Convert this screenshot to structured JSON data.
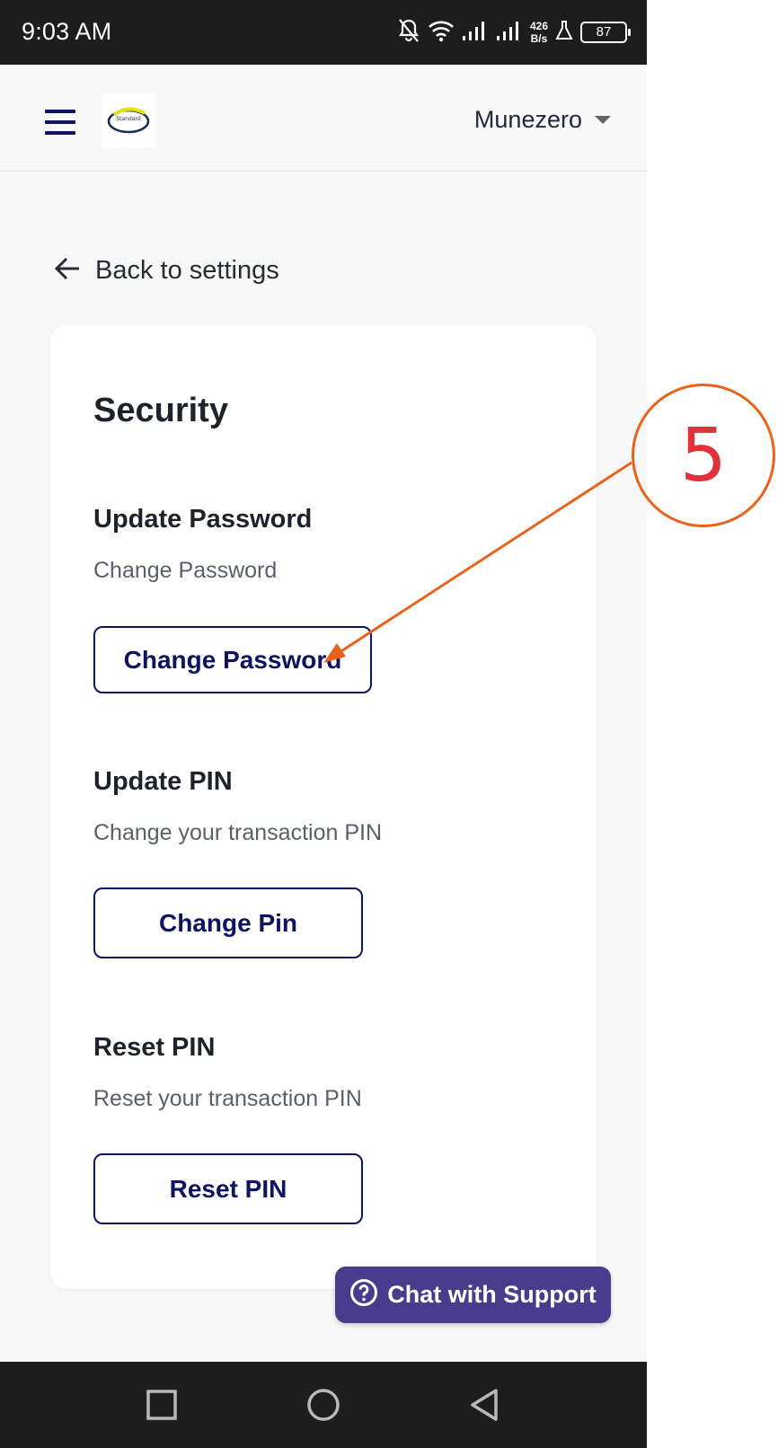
{
  "status_bar": {
    "time": "9:03 AM",
    "net_speed_value": "426",
    "net_speed_unit": "B/s",
    "battery": "87"
  },
  "header": {
    "user_name": "Munezero",
    "logo_text": "Standard"
  },
  "back_link": {
    "label": "Back to settings"
  },
  "card": {
    "title": "Security",
    "sections": [
      {
        "title": "Update Password",
        "description": "Change Password",
        "button": "Change Password"
      },
      {
        "title": "Update PIN",
        "description": "Change your transaction PIN",
        "button": "Change Pin"
      },
      {
        "title": "Reset PIN",
        "description": "Reset your transaction PIN",
        "button": "Reset PIN"
      }
    ]
  },
  "chat": {
    "label": "Chat with Support"
  },
  "annotation": {
    "number": "5",
    "circle_color": "#e8631b",
    "number_color": "#e0323b"
  },
  "colors": {
    "primary": "#0e1460",
    "chat_bg": "#4a3c8c",
    "status_bar_bg": "#1d1d1d",
    "page_bg": "#f8f8f9"
  }
}
